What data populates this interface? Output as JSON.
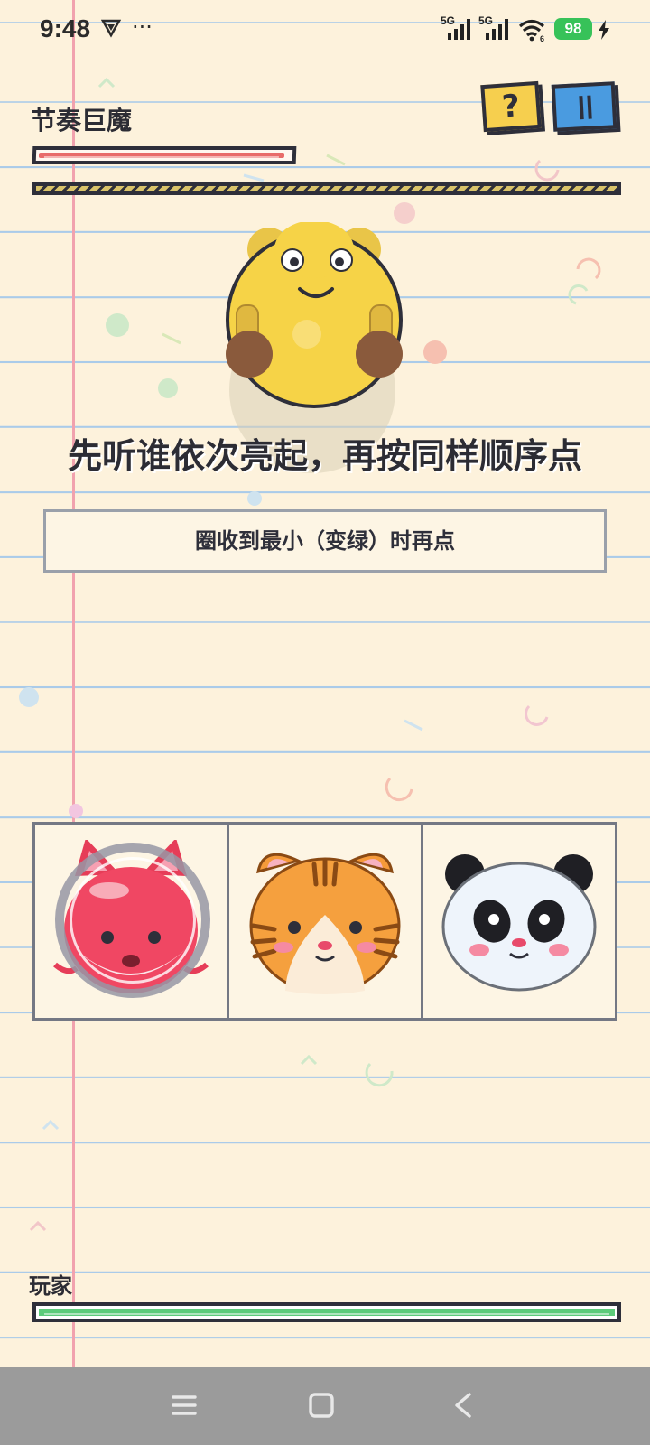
{
  "status_bar": {
    "time": "9:48",
    "more": "···",
    "signal1_label": "5G",
    "signal2_label": "5G",
    "wifi_label": "6",
    "battery": "98"
  },
  "boss": {
    "name": "节奏巨魔",
    "hp_fraction": 0.98
  },
  "header_buttons": {
    "help_label": "?",
    "pause_icon": "pause-icon"
  },
  "instruction": "先听谁依次亮起，再按同样顺序点",
  "hint": "圈收到最小（变绿）时再点",
  "pads": [
    {
      "animal": "fox",
      "icon": "fox-face-icon",
      "active_ring": true
    },
    {
      "animal": "tiger",
      "icon": "tiger-face-icon",
      "active_ring": false
    },
    {
      "animal": "panda",
      "icon": "panda-face-icon",
      "active_ring": false
    }
  ],
  "player": {
    "label": "玩家",
    "hp_fraction": 1.0
  },
  "colors": {
    "boss_hp": "#e86b6b",
    "player_hp": "#5ccb7a",
    "help_button": "#f6cf4e",
    "pause_button": "#4a9be0",
    "paper": "#fdf2dc",
    "paper_lines": "#aacbe9",
    "margin_line": "#f1a2ae"
  }
}
